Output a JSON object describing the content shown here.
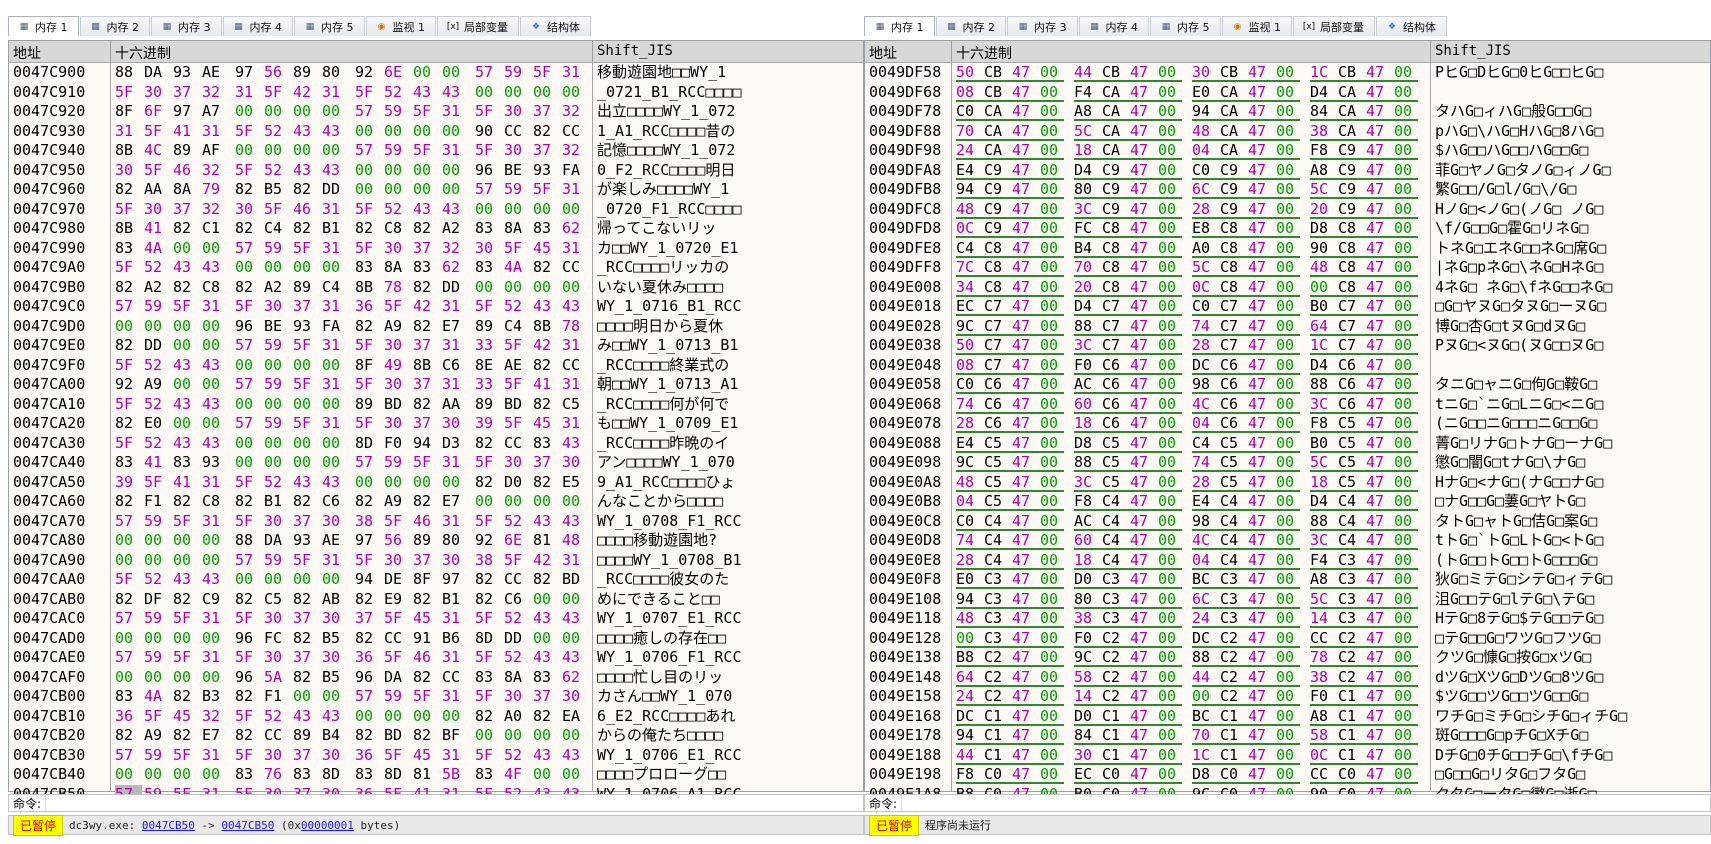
{
  "tabs": [
    {
      "label": "内存 1",
      "icon": "memory-icon"
    },
    {
      "label": "内存 2",
      "icon": "memory-icon"
    },
    {
      "label": "内存 3",
      "icon": "memory-icon"
    },
    {
      "label": "内存 4",
      "icon": "memory-icon"
    },
    {
      "label": "内存 5",
      "icon": "memory-icon"
    },
    {
      "label": "监视 1",
      "icon": "watch-icon"
    },
    {
      "label": "局部变量",
      "icon": "locals-icon"
    },
    {
      "label": "结构体",
      "icon": "struct-icon"
    }
  ],
  "columns": {
    "address": "地址",
    "hex": "十六进制",
    "text": "Shift_JIS"
  },
  "left_rows": [
    {
      "addr": "0047C900",
      "hex": "88 DA 93 AE 97 56 89 80 92 6E 00 00 57 59 5F 31",
      "text": "移動遊園地□□WY_1"
    },
    {
      "addr": "0047C910",
      "hex": "5F 30 37 32 31 5F 42 31 5F 52 43 43 00 00 00 00",
      "text": "_0721_B1_RCC□□□□"
    },
    {
      "addr": "0047C920",
      "hex": "8F 6F 97 A7 00 00 00 00 57 59 5F 31 5F 30 37 32",
      "text": "出立□□□□WY_1_072"
    },
    {
      "addr": "0047C930",
      "hex": "31 5F 41 31 5F 52 43 43 00 00 00 00 90 CC 82 CC",
      "text": "1_A1_RCC□□□□昔の"
    },
    {
      "addr": "0047C940",
      "hex": "8B 4C 89 AF 00 00 00 00 57 59 5F 31 5F 30 37 32",
      "text": "記憶□□□□WY_1_072"
    },
    {
      "addr": "0047C950",
      "hex": "30 5F 46 32 5F 52 43 43 00 00 00 00 96 BE 93 FA",
      "text": "0_F2_RCC□□□□明日"
    },
    {
      "addr": "0047C960",
      "hex": "82 AA 8A 79 82 B5 82 DD 00 00 00 00 57 59 5F 31",
      "text": "が楽しみ□□□□WY_1"
    },
    {
      "addr": "0047C970",
      "hex": "5F 30 37 32 30 5F 46 31 5F 52 43 43 00 00 00 00",
      "text": "_0720_F1_RCC□□□□"
    },
    {
      "addr": "0047C980",
      "hex": "8B 41 82 C1 82 C4 82 B1 82 C8 82 A2 83 8A 83 62",
      "text": "帰ってこないリッ"
    },
    {
      "addr": "0047C990",
      "hex": "83 4A 00 00 57 59 5F 31 5F 30 37 32 30 5F 45 31",
      "text": "カ□□WY_1_0720_E1"
    },
    {
      "addr": "0047C9A0",
      "hex": "5F 52 43 43 00 00 00 00 83 8A 83 62 83 4A 82 CC",
      "text": "_RCC□□□□リッカの"
    },
    {
      "addr": "0047C9B0",
      "hex": "82 A2 82 C8 82 A2 89 C4 8B 78 82 DD 00 00 00 00",
      "text": "いない夏休み□□□□"
    },
    {
      "addr": "0047C9C0",
      "hex": "57 59 5F 31 5F 30 37 31 36 5F 42 31 5F 52 43 43",
      "text": "WY_1_0716_B1_RCC"
    },
    {
      "addr": "0047C9D0",
      "hex": "00 00 00 00 96 BE 93 FA 82 A9 82 E7 89 C4 8B 78",
      "text": "□□□□明日から夏休"
    },
    {
      "addr": "0047C9E0",
      "hex": "82 DD 00 00 57 59 5F 31 5F 30 37 31 33 5F 42 31",
      "text": "み□□WY_1_0713_B1"
    },
    {
      "addr": "0047C9F0",
      "hex": "5F 52 43 43 00 00 00 00 8F 49 8B C6 8E AE 82 CC",
      "text": "_RCC□□□□終業式の"
    },
    {
      "addr": "0047CA00",
      "hex": "92 A9 00 00 57 59 5F 31 5F 30 37 31 33 5F 41 31",
      "text": "朝□□WY_1_0713_A1"
    },
    {
      "addr": "0047CA10",
      "hex": "5F 52 43 43 00 00 00 00 89 BD 82 AA 89 BD 82 C5",
      "text": "_RCC□□□□何が何で"
    },
    {
      "addr": "0047CA20",
      "hex": "82 E0 00 00 57 59 5F 31 5F 30 37 30 39 5F 45 31",
      "text": "も□□WY_1_0709_E1"
    },
    {
      "addr": "0047CA30",
      "hex": "5F 52 43 43 00 00 00 00 8D F0 94 D3 82 CC 83 43",
      "text": "_RCC□□□□昨晩のイ"
    },
    {
      "addr": "0047CA40",
      "hex": "83 41 83 93 00 00 00 00 57 59 5F 31 5F 30 37 30",
      "text": "アン□□□□WY_1_070"
    },
    {
      "addr": "0047CA50",
      "hex": "39 5F 41 31 5F 52 43 43 00 00 00 00 82 D0 82 E5",
      "text": "9_A1_RCC□□□□ひょ"
    },
    {
      "addr": "0047CA60",
      "hex": "82 F1 82 C8 82 B1 82 C6 82 A9 82 E7 00 00 00 00",
      "text": "んなことから□□□□"
    },
    {
      "addr": "0047CA70",
      "hex": "57 59 5F 31 5F 30 37 30 38 5F 46 31 5F 52 43 43",
      "text": "WY_1_0708_F1_RCC"
    },
    {
      "addr": "0047CA80",
      "hex": "00 00 00 00 88 DA 93 AE 97 56 89 80 92 6E 81 48",
      "text": "□□□□移動遊園地?"
    },
    {
      "addr": "0047CA90",
      "hex": "00 00 00 00 57 59 5F 31 5F 30 37 30 38 5F 42 31",
      "text": "□□□□WY_1_0708_B1"
    },
    {
      "addr": "0047CAA0",
      "hex": "5F 52 43 43 00 00 00 00 94 DE 8F 97 82 CC 82 BD",
      "text": "_RCC□□□□彼女のた"
    },
    {
      "addr": "0047CAB0",
      "hex": "82 DF 82 C9 82 C5 82 AB 82 E9 82 B1 82 C6 00 00",
      "text": "めにできること□□"
    },
    {
      "addr": "0047CAC0",
      "hex": "57 59 5F 31 5F 30 37 30 37 5F 45 31 5F 52 43 43",
      "text": "WY_1_0707_E1_RCC"
    },
    {
      "addr": "0047CAD0",
      "hex": "00 00 00 00 96 FC 82 B5 82 CC 91 B6 8D DD 00 00",
      "text": "□□□□癒しの存在□□"
    },
    {
      "addr": "0047CAE0",
      "hex": "57 59 5F 31 5F 30 37 30 36 5F 46 31 5F 52 43 43",
      "text": "WY_1_0706_F1_RCC"
    },
    {
      "addr": "0047CAF0",
      "hex": "00 00 00 00 96 5A 82 B5 96 DA 82 CC 83 8A 83 62",
      "text": "□□□□忙し目のリッ"
    },
    {
      "addr": "0047CB00",
      "hex": "83 4A 82 B3 82 F1 00 00 57 59 5F 31 5F 30 37 30",
      "text": "カさん□□WY_1_070"
    },
    {
      "addr": "0047CB10",
      "hex": "36 5F 45 32 5F 52 43 43 00 00 00 00 82 A0 82 EA",
      "text": "6_E2_RCC□□□□あれ"
    },
    {
      "addr": "0047CB20",
      "hex": "82 A9 82 E7 82 CC 89 B4 82 BD 82 BF 00 00 00 00",
      "text": "からの俺たち□□□□"
    },
    {
      "addr": "0047CB30",
      "hex": "57 59 5F 31 5F 30 37 30 36 5F 45 31 5F 52 43 43",
      "text": "WY_1_0706_E1_RCC"
    },
    {
      "addr": "0047CB40",
      "hex": "00 00 00 00 83 76 83 8D 83 8D 81 5B 83 4F 00 00",
      "text": "□□□□プロローグ□□"
    },
    {
      "addr": "0047CB50",
      "hex": "57 59 5F 31 5F 30 37 30 36 5F 41 31 5F 52 43 43",
      "text": "WY_1_0706_A1_RCC"
    }
  ],
  "right_rows": [
    {
      "addr": "0049DF58",
      "hex": "50 CB 47 00 44 CB 47 00 30 CB 47 00 1C CB 47 00",
      "text": "PヒG□DヒG□0ヒG□□ヒG□"
    },
    {
      "addr": "0049DF68",
      "hex": "08 CB 47 00 F4 CA 47 00 E0 CA 47 00 D4 CA 47 00",
      "text": ""
    },
    {
      "addr": "0049DF78",
      "hex": "C0 CA 47 00 A8 CA 47 00 94 CA 47 00 84 CA 47 00",
      "text": "タハG□ィハG□般G□□G□"
    },
    {
      "addr": "0049DF88",
      "hex": "70 CA 47 00 5C CA 47 00 48 CA 47 00 38 CA 47 00",
      "text": "pハG□\\ハG□HハG□8ハG□"
    },
    {
      "addr": "0049DF98",
      "hex": "24 CA 47 00 18 CA 47 00 04 CA 47 00 F8 C9 47 00",
      "text": "$ハG□□ハG□□ハG□□G□"
    },
    {
      "addr": "0049DFA8",
      "hex": "E4 C9 47 00 D4 C9 47 00 C0 C9 47 00 A8 C9 47 00",
      "text": "菲G□ヤノG□タノG□ィノG□"
    },
    {
      "addr": "0049DFB8",
      "hex": "94 C9 47 00 80 C9 47 00 6C C9 47 00 5C C9 47 00",
      "text": "繁G□□/G□l/G□\\/G□"
    },
    {
      "addr": "0049DFC8",
      "hex": "48 C9 47 00 3C C9 47 00 28 C9 47 00 20 C9 47 00",
      "text": "HノG□<ノG□(ノG□ ノG□"
    },
    {
      "addr": "0049DFD8",
      "hex": "0C C9 47 00 FC C8 47 00 E8 C8 47 00 D8 C8 47 00",
      "text": "\\f/G□□G□霍G□リネG□"
    },
    {
      "addr": "0049DFE8",
      "hex": "C4 C8 47 00 B4 C8 47 00 A0 C8 47 00 90 C8 47 00",
      "text": "トネG□エネG□□ネG□席G□"
    },
    {
      "addr": "0049DFF8",
      "hex": "7C C8 47 00 70 C8 47 00 5C C8 47 00 48 C8 47 00",
      "text": "|ネG□pネG□\\ネG□HネG□"
    },
    {
      "addr": "0049E008",
      "hex": "34 C8 47 00 20 C8 47 00 0C C8 47 00 00 C8 47 00",
      "text": "4ネG□ ネG□\\fネG□□ネG□"
    },
    {
      "addr": "0049E018",
      "hex": "EC C7 47 00 D4 C7 47 00 C0 C7 47 00 B0 C7 47 00",
      "text": "□G□ヤヌG□タヌG□ーヌG□"
    },
    {
      "addr": "0049E028",
      "hex": "9C C7 47 00 88 C7 47 00 74 C7 47 00 64 C7 47 00",
      "text": "博G□杏G□tヌG□dヌG□"
    },
    {
      "addr": "0049E038",
      "hex": "50 C7 47 00 3C C7 47 00 28 C7 47 00 1C C7 47 00",
      "text": "PヌG□<ヌG□(ヌG□□ヌG□"
    },
    {
      "addr": "0049E048",
      "hex": "08 C7 47 00 F0 C6 47 00 DC C6 47 00 D4 C6 47 00",
      "text": ""
    },
    {
      "addr": "0049E058",
      "hex": "C0 C6 47 00 AC C6 47 00 98 C6 47 00 88 C6 47 00",
      "text": "タニG□ャニG□佝G□鞍G□"
    },
    {
      "addr": "0049E068",
      "hex": "74 C6 47 00 60 C6 47 00 4C C6 47 00 3C C6 47 00",
      "text": "tニG□`ニG□LニG□<ニG□"
    },
    {
      "addr": "0049E078",
      "hex": "28 C6 47 00 18 C6 47 00 04 C6 47 00 F8 C5 47 00",
      "text": "(ニG□□ニG□□□ニG□□G□"
    },
    {
      "addr": "0049E088",
      "hex": "E4 C5 47 00 D8 C5 47 00 C4 C5 47 00 B0 C5 47 00",
      "text": "菁G□リナG□トナG□ーナG□"
    },
    {
      "addr": "0049E098",
      "hex": "9C C5 47 00 88 C5 47 00 74 C5 47 00 5C C5 47 00",
      "text": "懲G□闇G□tナG□\\ナG□"
    },
    {
      "addr": "0049E0A8",
      "hex": "48 C5 47 00 3C C5 47 00 28 C5 47 00 18 C5 47 00",
      "text": "HナG□<ナG□(ナG□□ナG□"
    },
    {
      "addr": "0049E0B8",
      "hex": "04 C5 47 00 F8 C4 47 00 E4 C4 47 00 D4 C4 47 00",
      "text": "□ナG□□G□萋G□ヤトG□"
    },
    {
      "addr": "0049E0C8",
      "hex": "C0 C4 47 00 AC C4 47 00 98 C4 47 00 88 C4 47 00",
      "text": "タトG□ャトG□佶G□案G□"
    },
    {
      "addr": "0049E0D8",
      "hex": "74 C4 47 00 60 C4 47 00 4C C4 47 00 3C C4 47 00",
      "text": "tトG□`トG□LトG□<トG□"
    },
    {
      "addr": "0049E0E8",
      "hex": "28 C4 47 00 18 C4 47 00 04 C4 47 00 F4 C3 47 00",
      "text": "(トG□□トG□□トG□□□G□"
    },
    {
      "addr": "0049E0F8",
      "hex": "E0 C3 47 00 D0 C3 47 00 BC C3 47 00 A8 C3 47 00",
      "text": "狄G□ミテG□シテG□ィテG□"
    },
    {
      "addr": "0049E108",
      "hex": "94 C3 47 00 80 C3 47 00 6C C3 47 00 5C C3 47 00",
      "text": "沮G□□テG□lテG□\\テG□"
    },
    {
      "addr": "0049E118",
      "hex": "48 C3 47 00 38 C3 47 00 24 C3 47 00 14 C3 47 00",
      "text": "HテG□8テG□$テG□□テG□"
    },
    {
      "addr": "0049E128",
      "hex": "00 C3 47 00 F0 C2 47 00 DC C2 47 00 CC C2 47 00",
      "text": "□テG□□G□ワツG□フツG□"
    },
    {
      "addr": "0049E138",
      "hex": "B8 C2 47 00 9C C2 47 00 88 C2 47 00 78 C2 47 00",
      "text": "クツG□慷G□按G□xツG□"
    },
    {
      "addr": "0049E148",
      "hex": "64 C2 47 00 58 C2 47 00 44 C2 47 00 38 C2 47 00",
      "text": "dツG□XツG□DツG□8ツG□"
    },
    {
      "addr": "0049E158",
      "hex": "24 C2 47 00 14 C2 47 00 00 C2 47 00 F0 C1 47 00",
      "text": "$ツG□□ツG□□ツG□□G□"
    },
    {
      "addr": "0049E168",
      "hex": "DC C1 47 00 D0 C1 47 00 BC C1 47 00 A8 C1 47 00",
      "text": "ワチG□ミチG□シチG□ィチG□"
    },
    {
      "addr": "0049E178",
      "hex": "94 C1 47 00 84 C1 47 00 70 C1 47 00 58 C1 47 00",
      "text": "斑G□□□G□pチG□XチG□"
    },
    {
      "addr": "0049E188",
      "hex": "44 C1 47 00 30 C1 47 00 1C C1 47 00 0C C1 47 00",
      "text": "DチG□0チG□□チG□\\fチG□"
    },
    {
      "addr": "0049E198",
      "hex": "F8 C0 47 00 EC C0 47 00 D8 C0 47 00 CC C0 47 00",
      "text": "□G□□G□リタG□フタG□"
    },
    {
      "addr": "0049E1A8",
      "hex": "B8 C0 47 00 B0 C0 47 00 9C C0 47 00 90 C0 47 00",
      "text": "クタG□ータG□懲G□逝G□"
    }
  ],
  "command": {
    "label": "命令:",
    "value": ""
  },
  "status": {
    "left_badge": "已暂停",
    "left_prefix": "dc3wy.exe: ",
    "left_start": "0047CB50",
    "left_arrow": " -> ",
    "left_end": "0047CB50",
    "left_size_pre": " (0x",
    "left_size": "00000001",
    "left_size_post": " bytes)",
    "right_badge": "已暂停",
    "right_text": "程序尚未运行"
  },
  "colors": {
    "zero": "#00a000",
    "high": "#b000b0",
    "normal": "#000000",
    "dword_underline": "#2f8a2f",
    "paused_badge": "#ffff00"
  }
}
